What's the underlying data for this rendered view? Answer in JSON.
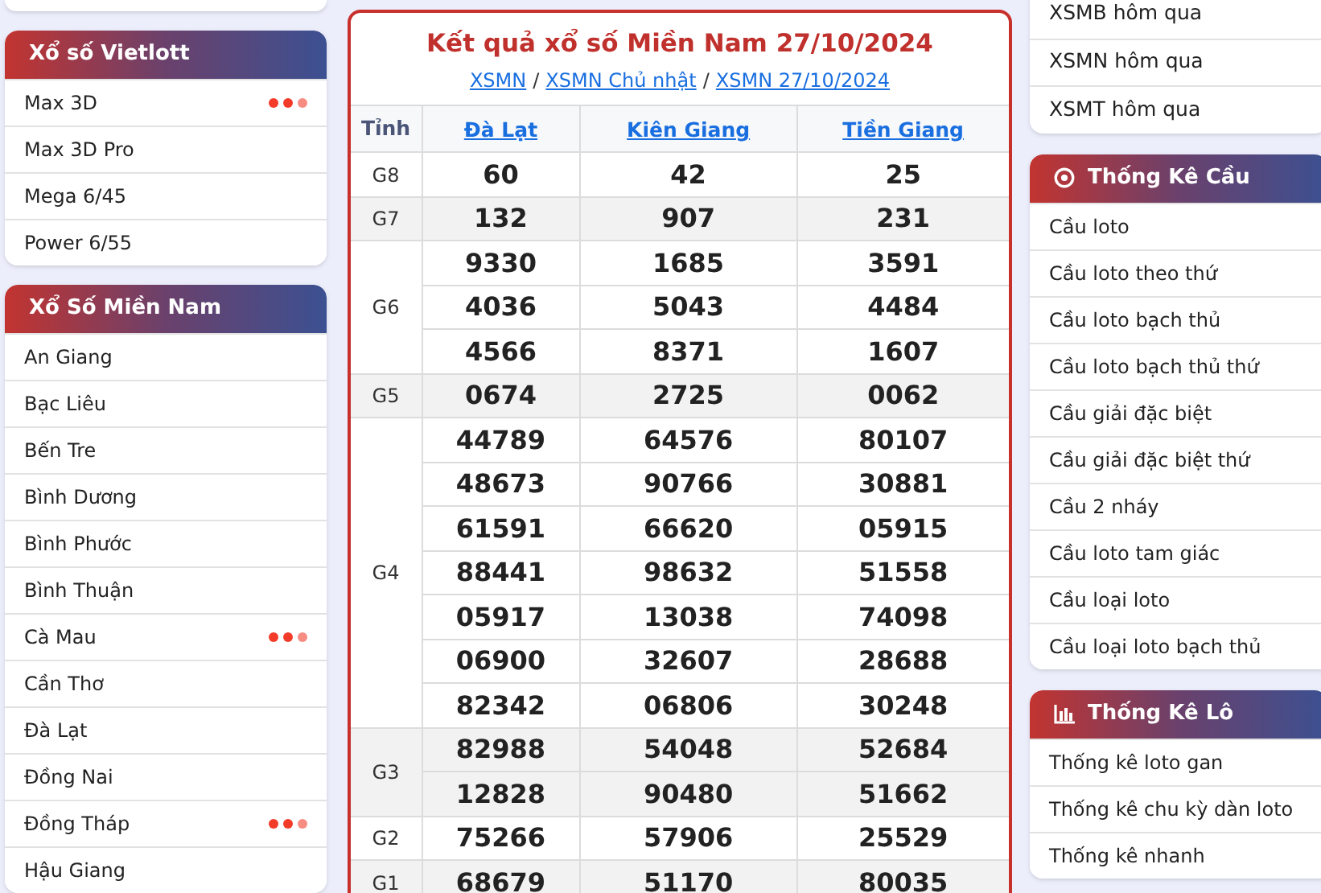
{
  "left_sidebar": {
    "sections": [
      {
        "title": "Xổ số Vietlott",
        "items": [
          {
            "label": "Max 3D",
            "hot": true
          },
          {
            "label": "Max 3D Pro",
            "hot": false
          },
          {
            "label": "Mega 6/45",
            "hot": false
          },
          {
            "label": "Power 6/55",
            "hot": false
          }
        ]
      },
      {
        "title": "Xổ Số Miền Nam",
        "items": [
          {
            "label": "An Giang",
            "hot": false
          },
          {
            "label": "Bạc Liêu",
            "hot": false
          },
          {
            "label": "Bến Tre",
            "hot": false
          },
          {
            "label": "Bình Dương",
            "hot": false
          },
          {
            "label": "Bình Phước",
            "hot": false
          },
          {
            "label": "Bình Thuận",
            "hot": false
          },
          {
            "label": "Cà Mau",
            "hot": true
          },
          {
            "label": "Cần Thơ",
            "hot": false
          },
          {
            "label": "Đà Lạt",
            "hot": false
          },
          {
            "label": "Đồng Nai",
            "hot": false
          },
          {
            "label": "Đồng Tháp",
            "hot": true
          },
          {
            "label": "Hậu Giang",
            "hot": false
          }
        ]
      }
    ]
  },
  "results": {
    "title": "Kết quả xổ số Miền Nam 27/10/2024",
    "breadcrumbs": [
      "XSMN",
      "XSMN Chủ nhật",
      "XSMN 27/10/2024"
    ],
    "breadcrumb_separator": "/",
    "province_heading": "Tỉnh",
    "provinces": [
      "Đà Lạt",
      "Kiên Giang",
      "Tiền Giang"
    ],
    "prizes": [
      {
        "name": "G8",
        "numbers": [
          [
            "60",
            "42",
            "25"
          ]
        ]
      },
      {
        "name": "G7",
        "numbers": [
          [
            "132",
            "907",
            "231"
          ]
        ]
      },
      {
        "name": "G6",
        "numbers": [
          [
            "9330",
            "1685",
            "3591"
          ],
          [
            "4036",
            "5043",
            "4484"
          ],
          [
            "4566",
            "8371",
            "1607"
          ]
        ]
      },
      {
        "name": "G5",
        "numbers": [
          [
            "0674",
            "2725",
            "0062"
          ]
        ]
      },
      {
        "name": "G4",
        "numbers": [
          [
            "44789",
            "64576",
            "80107"
          ],
          [
            "48673",
            "90766",
            "30881"
          ],
          [
            "61591",
            "66620",
            "05915"
          ],
          [
            "88441",
            "98632",
            "51558"
          ],
          [
            "05917",
            "13038",
            "74098"
          ],
          [
            "06900",
            "32607",
            "28688"
          ],
          [
            "82342",
            "06806",
            "30248"
          ]
        ]
      },
      {
        "name": "G3",
        "numbers": [
          [
            "82988",
            "54048",
            "52684"
          ],
          [
            "12828",
            "90480",
            "51662"
          ]
        ]
      },
      {
        "name": "G2",
        "numbers": [
          [
            "75266",
            "57906",
            "25529"
          ]
        ]
      },
      {
        "name": "G1",
        "numbers": [
          [
            "68679",
            "51170",
            "80035"
          ]
        ]
      }
    ]
  },
  "right_sidebar": {
    "links": [
      "XSMB hôm qua",
      "XSMN hôm qua",
      "XSMT hôm qua"
    ],
    "sections": [
      {
        "title": "Thống Kê Cầu",
        "kind": "target",
        "items": [
          "Cầu loto",
          "Cầu loto theo thứ",
          "Cầu loto bạch thủ",
          "Cầu loto bạch thủ thứ",
          "Cầu giải đặc biệt",
          "Cầu giải đặc biệt thứ",
          "Cầu 2 nháy",
          "Cầu loto tam giác",
          "Cầu loại loto",
          "Cầu loại loto bạch thủ"
        ]
      },
      {
        "title": "Thống Kê Lô",
        "kind": "chart",
        "items": [
          "Thống kê loto gan",
          "Thống kê chu kỳ dàn loto",
          "Thống kê nhanh"
        ]
      }
    ]
  }
}
